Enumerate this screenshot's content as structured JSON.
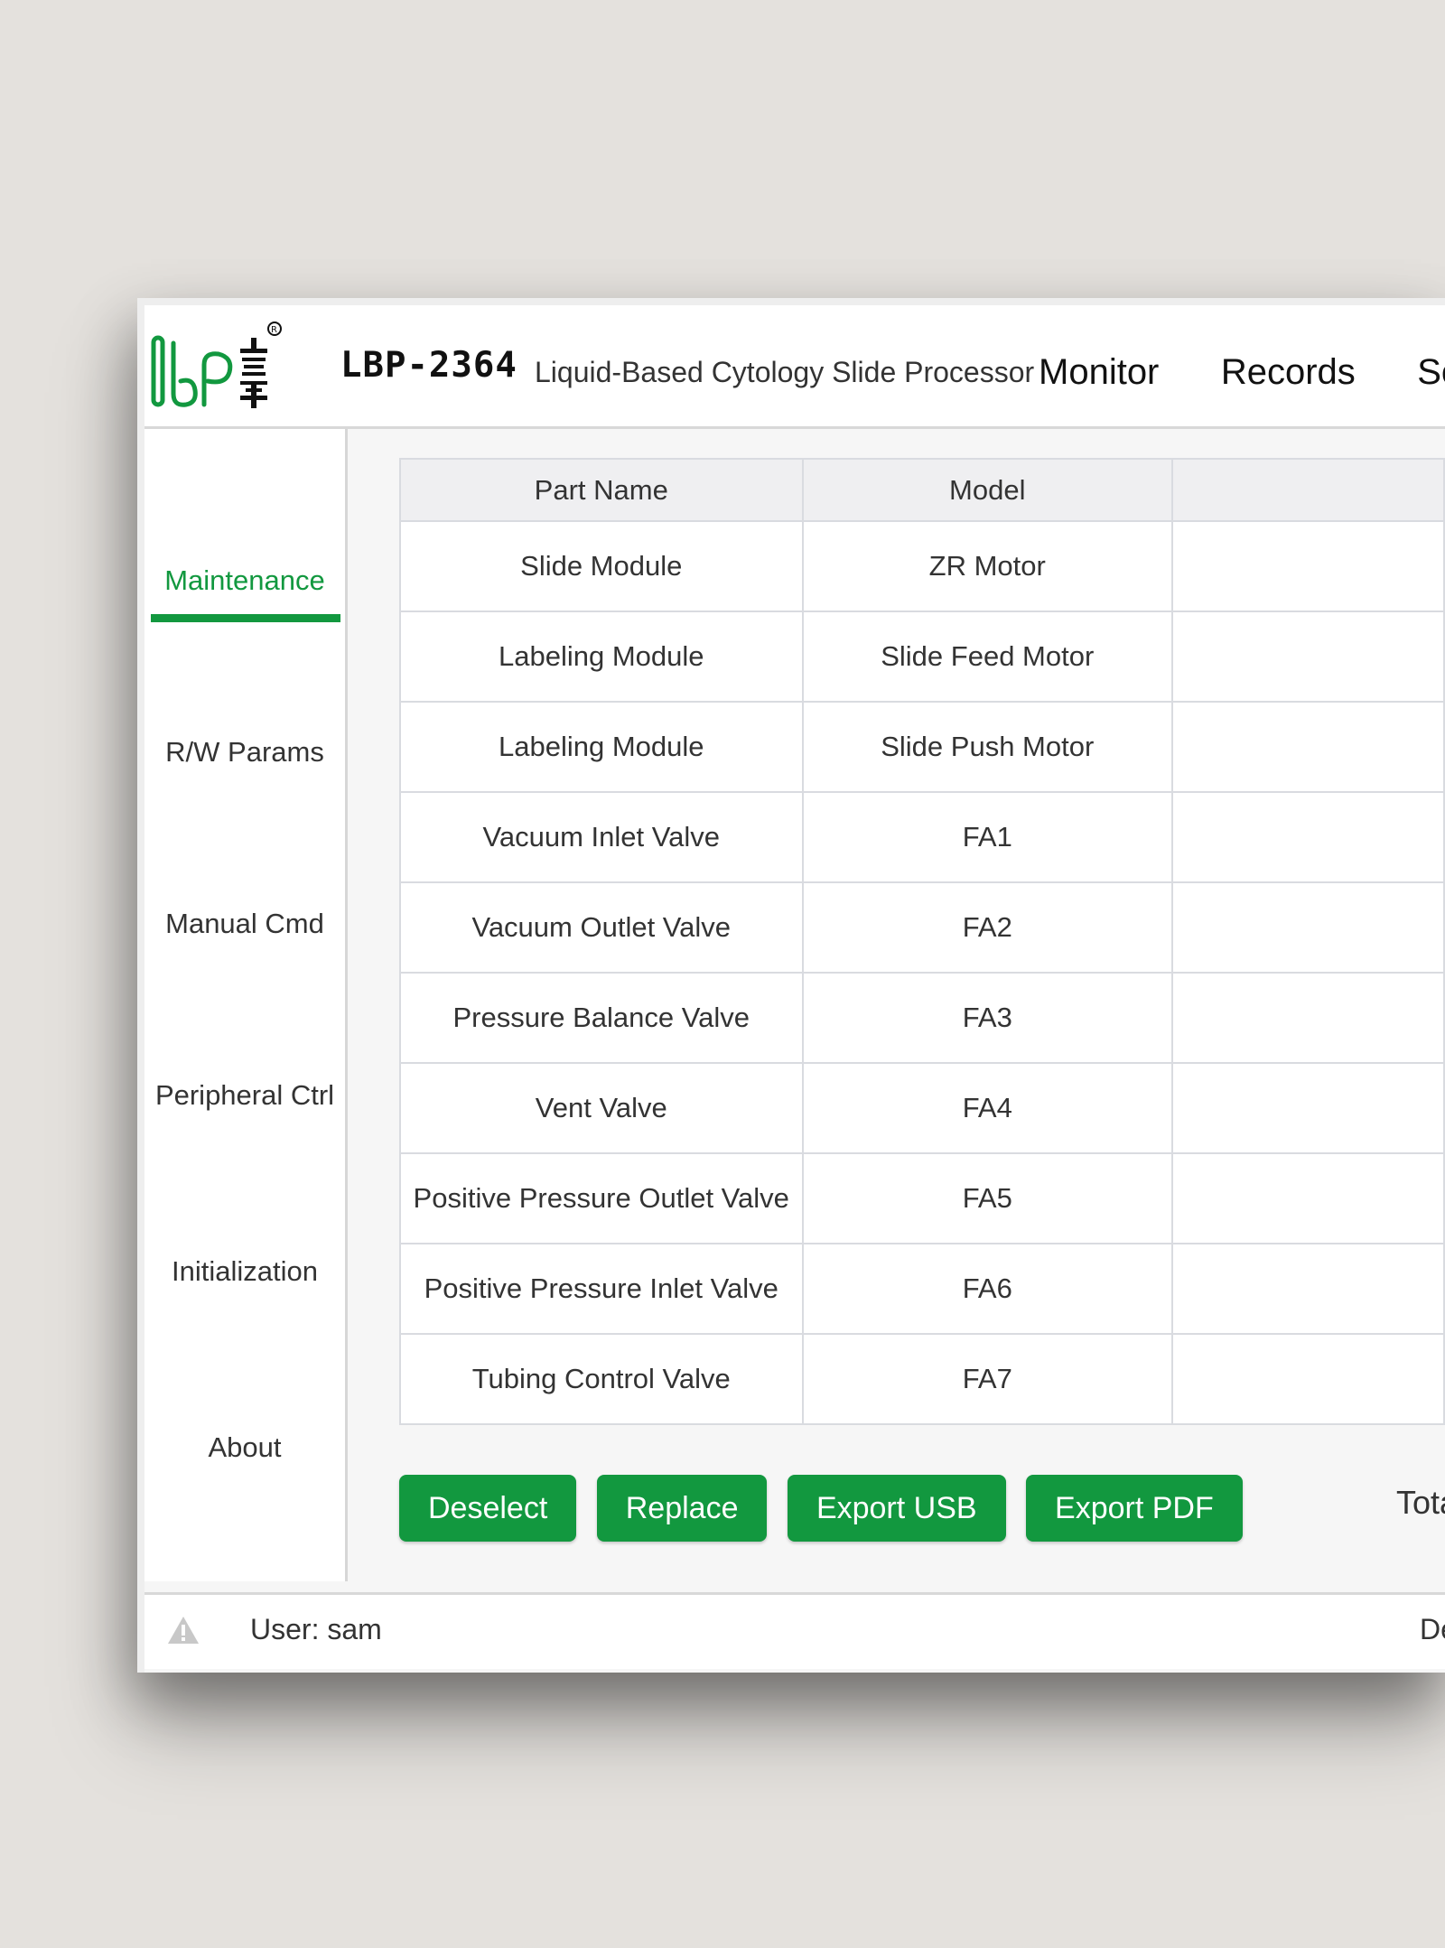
{
  "header": {
    "product_code": "LBP-2364",
    "product_name": "Liquid-Based Cytology Slide Processor",
    "nav": [
      "Monitor",
      "Records",
      "Set"
    ]
  },
  "sidebar": {
    "items": [
      {
        "label": "Maintenance",
        "active": true
      },
      {
        "label": "R/W Params",
        "active": false
      },
      {
        "label": "Manual Cmd",
        "active": false
      },
      {
        "label": "Peripheral Ctrl",
        "active": false
      },
      {
        "label": "Initialization",
        "active": false
      },
      {
        "label": "About",
        "active": false
      }
    ]
  },
  "table": {
    "columns": [
      "Part Name",
      "Model",
      ""
    ],
    "rows": [
      [
        "Slide Module",
        "ZR Motor",
        ""
      ],
      [
        "Labeling Module",
        "Slide Feed Motor",
        ""
      ],
      [
        "Labeling Module",
        "Slide Push Motor",
        ""
      ],
      [
        "Vacuum Inlet Valve",
        "FA1",
        ""
      ],
      [
        "Vacuum Outlet Valve",
        "FA2",
        ""
      ],
      [
        "Pressure Balance Valve",
        "FA3",
        ""
      ],
      [
        "Vent Valve",
        "FA4",
        ""
      ],
      [
        "Positive Pressure Outlet Valve",
        "FA5",
        ""
      ],
      [
        "Positive Pressure Inlet Valve",
        "FA6",
        ""
      ],
      [
        "Tubing Control Valve",
        "FA7",
        ""
      ]
    ]
  },
  "actions": {
    "deselect": "Deselect",
    "replace": "Replace",
    "export_usb": "Export USB",
    "export_pdf": "Export PDF",
    "total": "Tota"
  },
  "status": {
    "user": "User: sam",
    "right": "De"
  },
  "colors": {
    "accent": "#12983f",
    "warn_icon": "#c8c8c8"
  },
  "icons": {
    "logo": "lbp-logo",
    "status": "warning-icon"
  }
}
